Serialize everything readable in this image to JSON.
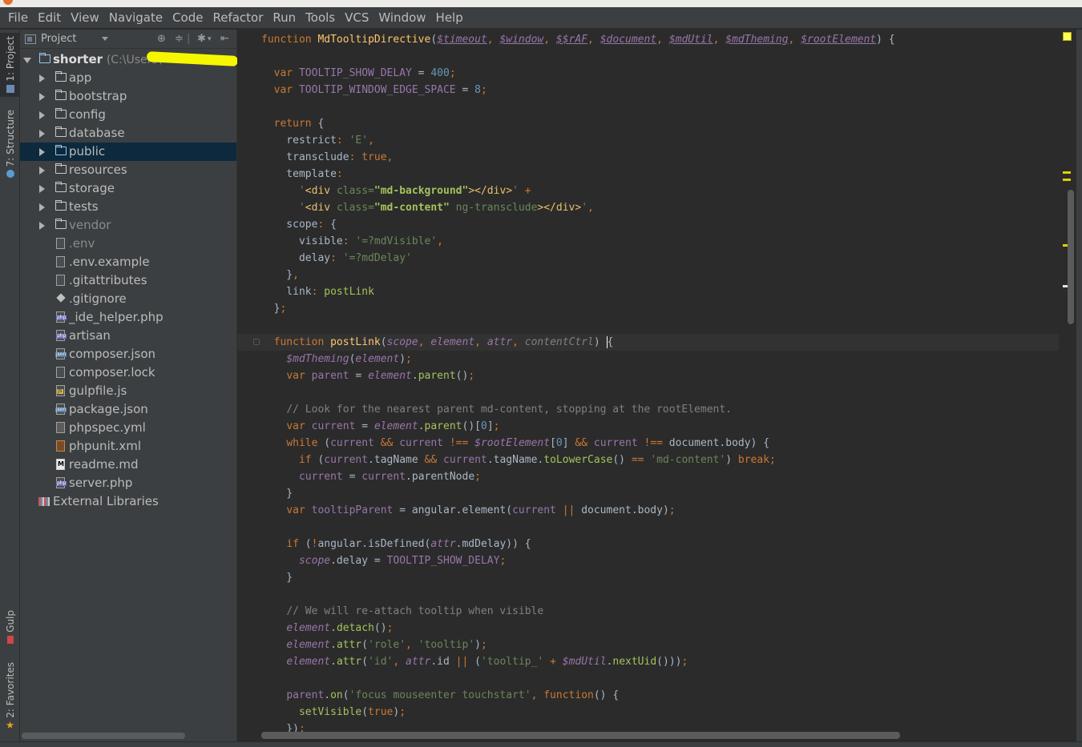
{
  "menu": [
    "File",
    "Edit",
    "View",
    "Navigate",
    "Code",
    "Refactor",
    "Run",
    "Tools",
    "VCS",
    "Window",
    "Help"
  ],
  "left_tabs": {
    "project": "1: Project",
    "structure": "7: Structure",
    "gulp": "Gulp",
    "favorites": "2: Favorites"
  },
  "project_panel": {
    "title": "Project",
    "root_name": "shorter",
    "root_path": "(C:\\Users\\",
    "items": [
      {
        "label": "app",
        "type": "folder"
      },
      {
        "label": "bootstrap",
        "type": "folder"
      },
      {
        "label": "config",
        "type": "folder"
      },
      {
        "label": "database",
        "type": "folder"
      },
      {
        "label": "public",
        "type": "folder",
        "selected": true
      },
      {
        "label": "resources",
        "type": "folder"
      },
      {
        "label": "storage",
        "type": "folder"
      },
      {
        "label": "tests",
        "type": "folder"
      },
      {
        "label": "vendor",
        "type": "folder",
        "dim": true
      },
      {
        "label": ".env",
        "type": "text",
        "dim": true
      },
      {
        "label": ".env.example",
        "type": "text"
      },
      {
        "label": ".gitattributes",
        "type": "text"
      },
      {
        "label": ".gitignore",
        "type": "git"
      },
      {
        "label": "_ide_helper.php",
        "type": "php"
      },
      {
        "label": "artisan",
        "type": "php"
      },
      {
        "label": "composer.json",
        "type": "json"
      },
      {
        "label": "composer.lock",
        "type": "text"
      },
      {
        "label": "gulpfile.js",
        "type": "js"
      },
      {
        "label": "package.json",
        "type": "json"
      },
      {
        "label": "phpspec.yml",
        "type": "yml"
      },
      {
        "label": "phpunit.xml",
        "type": "xml"
      },
      {
        "label": "readme.md",
        "type": "md"
      },
      {
        "label": "server.php",
        "type": "php"
      }
    ],
    "external": "External Libraries"
  },
  "code": {
    "l1_fn": "MdTooltipDirective",
    "l1_params": [
      "$timeout",
      "$window",
      "$$rAF",
      "$document",
      "$mdUtil",
      "$mdTheming",
      "$rootElement"
    ],
    "const1_name": "TOOLTIP_SHOW_DELAY",
    "const1_val": "400",
    "const2_name": "TOOLTIP_WINDOW_EDGE_SPACE",
    "const2_val": "8",
    "restrict_val": "'E'",
    "template_l1a": "'",
    "template_l1b": "<div ",
    "template_l1c": "class=",
    "template_l1d": "\"md-background\"",
    "template_l1e": "></div>",
    "template_l1f": "'",
    "template_l2d": "\"md-content\"",
    "template_l2g": " ng-transclude",
    "template_l2e": "></div>",
    "scope_visible": "'=?mdVisible'",
    "scope_delay": "'=?mdDelay'",
    "link_val": "postLink",
    "postlink_params": [
      "scope",
      "element",
      "attr"
    ],
    "postlink_last": "contentCtrl",
    "comment1": "// Look for the nearest parent md-content, stopping at the rootElement.",
    "mdcontent_str": "'md-content'",
    "comment2": "// We will re-attach tooltip when visible",
    "role_k": "'role'",
    "role_v": "'tooltip'",
    "id_k": "'id'",
    "id_prefix": "'tooltip_'",
    "events": "'focus mouseenter touchstart'"
  }
}
